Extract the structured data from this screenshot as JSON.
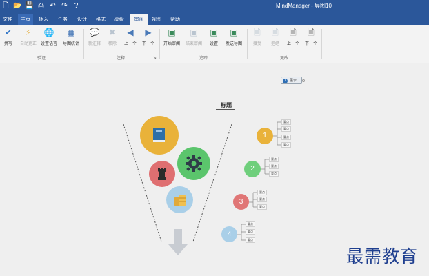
{
  "window": {
    "title": "MindManager - 导图10"
  },
  "quick_access": [
    {
      "name": "new-icon",
      "glyph": "🗋"
    },
    {
      "name": "open-icon",
      "glyph": "📂"
    },
    {
      "name": "save-icon",
      "glyph": "💾"
    },
    {
      "name": "print-icon",
      "glyph": "⎙"
    },
    {
      "name": "undo-icon",
      "glyph": "↶"
    },
    {
      "name": "redo-icon",
      "glyph": "↷"
    },
    {
      "name": "help-icon",
      "glyph": "?"
    }
  ],
  "tabs": [
    {
      "label": "文件"
    },
    {
      "label": "主页"
    },
    {
      "label": "插入"
    },
    {
      "label": "任务"
    },
    {
      "label": "设计"
    },
    {
      "label": "格式"
    },
    {
      "label": "高级"
    },
    {
      "label": "审阅"
    },
    {
      "label": "视图"
    },
    {
      "label": "帮助"
    }
  ],
  "ribbon": {
    "groups": [
      {
        "label": "验证"
      },
      {
        "label": "注释"
      },
      {
        "label": "追踪"
      },
      {
        "label": "更改"
      }
    ],
    "buttons": [
      {
        "label": "拼写",
        "icon": "spellcheck-icon",
        "glyph": "✔"
      },
      {
        "label": "自动更正",
        "icon": "autocorrect-icon",
        "glyph": "⚡"
      },
      {
        "label": "设置语言",
        "icon": "language-icon",
        "glyph": "🌐"
      },
      {
        "label": "导图统计",
        "icon": "statistics-icon",
        "glyph": "▦"
      },
      {
        "label": "新注释",
        "icon": "new-comment-icon",
        "glyph": "💬"
      },
      {
        "label": "移除",
        "icon": "remove-comment-icon",
        "glyph": "✖"
      },
      {
        "label": "上一个",
        "icon": "previous-comment-icon",
        "glyph": "◀"
      },
      {
        "label": "下一个",
        "icon": "next-comment-icon",
        "glyph": "▶"
      },
      {
        "label": "开始审阅",
        "icon": "start-review-icon",
        "glyph": "▣"
      },
      {
        "label": "结束审阅",
        "icon": "end-review-icon",
        "glyph": "▣"
      },
      {
        "label": "设置",
        "icon": "review-settings-icon",
        "glyph": "▣"
      },
      {
        "label": "发送导图",
        "icon": "send-map-icon",
        "glyph": "▣"
      },
      {
        "label": "接受",
        "icon": "accept-change-icon",
        "glyph": "🗎"
      },
      {
        "label": "拒绝",
        "icon": "reject-change-icon",
        "glyph": "🗎"
      },
      {
        "label": "上一个",
        "icon": "previous-change-icon",
        "glyph": "🗎"
      },
      {
        "label": "下一个",
        "icon": "next-change-icon",
        "glyph": "🗎"
      }
    ]
  },
  "canvas": {
    "notes_label": "展示",
    "central_topic": "标题",
    "numbers": [
      "1",
      "2",
      "3",
      "4"
    ],
    "subtopic_label": "要点",
    "icons": {
      "book": "book-icon",
      "gear": "gear-icon",
      "rook": "chess-rook-icon",
      "coins": "coins-icon"
    },
    "colors": {
      "yellow": "#e9b23a",
      "green": "#5bc56c",
      "red": "#df6f71",
      "blue": "#a9cfe8"
    }
  },
  "watermark": "最需教育"
}
